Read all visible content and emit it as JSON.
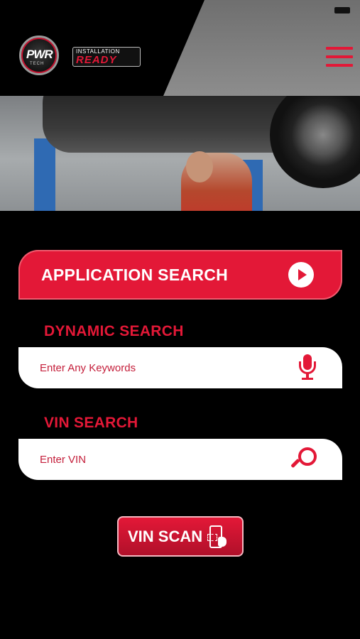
{
  "header": {
    "logo_main_text": "PWR",
    "logo_main_sub": "TECH",
    "logo_badge_line1": "INSTALLATION",
    "logo_badge_line2": "READY",
    "menu_icon": "hamburger-icon",
    "accent_color": "#e31837"
  },
  "hero": {
    "image_description": "mechanic-under-car-photo"
  },
  "application_search": {
    "label": "APPLICATION SEARCH",
    "icon": "play-circle-icon"
  },
  "dynamic_search": {
    "title": "DYNAMIC SEARCH",
    "placeholder": "Enter Any Keywords",
    "value": "",
    "icon": "microphone-icon"
  },
  "vin_search": {
    "title": "VIN SEARCH",
    "placeholder": "Enter VIN",
    "value": "",
    "icon": "search-icon"
  },
  "vin_scan": {
    "label": "VIN SCAN",
    "icon": "barcode-scan-icon"
  }
}
